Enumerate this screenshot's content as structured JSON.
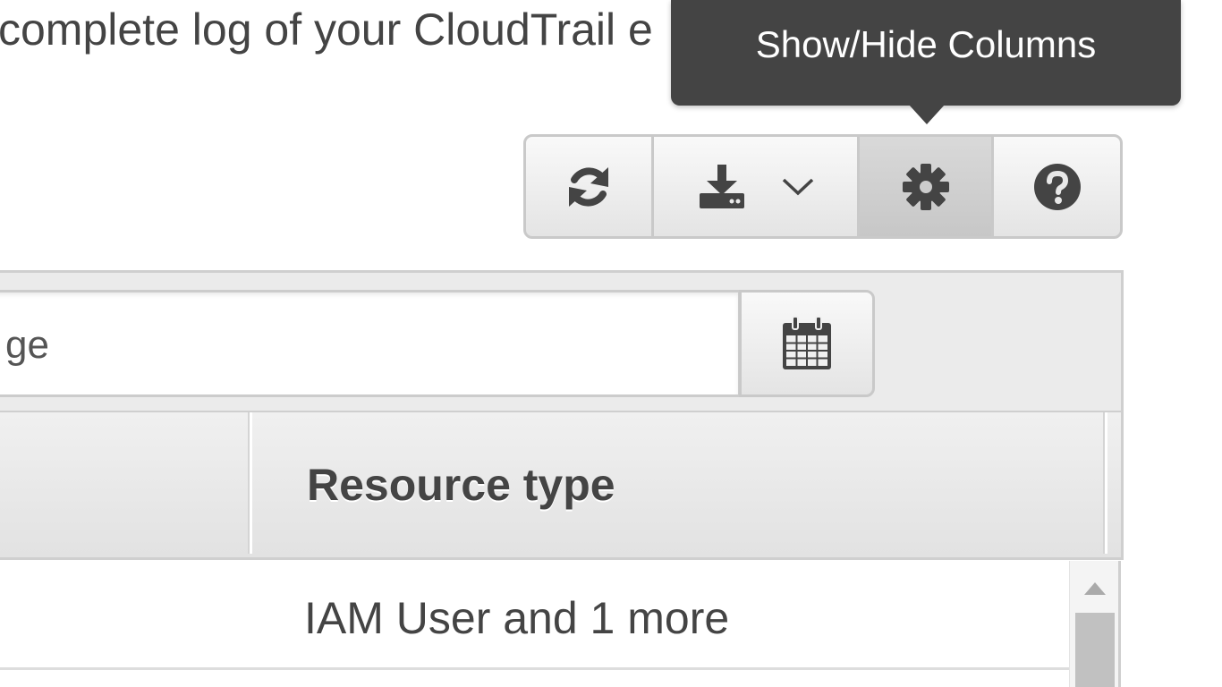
{
  "intro": {
    "text": "complete log of your CloudTrail e"
  },
  "tooltip": {
    "text": "Show/Hide Columns"
  },
  "toolbar": {
    "buttons": [
      {
        "name": "refresh",
        "icon": "refresh-icon"
      },
      {
        "name": "download",
        "icon": "download-icon",
        "caret": "chevron-down-icon"
      },
      {
        "name": "show-hide-columns",
        "icon": "gear-icon",
        "active": true
      },
      {
        "name": "help",
        "icon": "question-circle-icon"
      }
    ]
  },
  "filter": {
    "date_range_value": "ge",
    "calendar_icon": "calendar-icon"
  },
  "table": {
    "columns": [
      {
        "label": ""
      },
      {
        "label": "Resource type"
      }
    ],
    "rows": [
      {
        "resource_type": "IAM User and 1 more"
      }
    ]
  },
  "colors": {
    "tooltip_bg": "#444444",
    "text": "#444444",
    "border": "#c9c9c9",
    "header_bg": "#e8e8e8",
    "active_button": "#cccccc"
  }
}
